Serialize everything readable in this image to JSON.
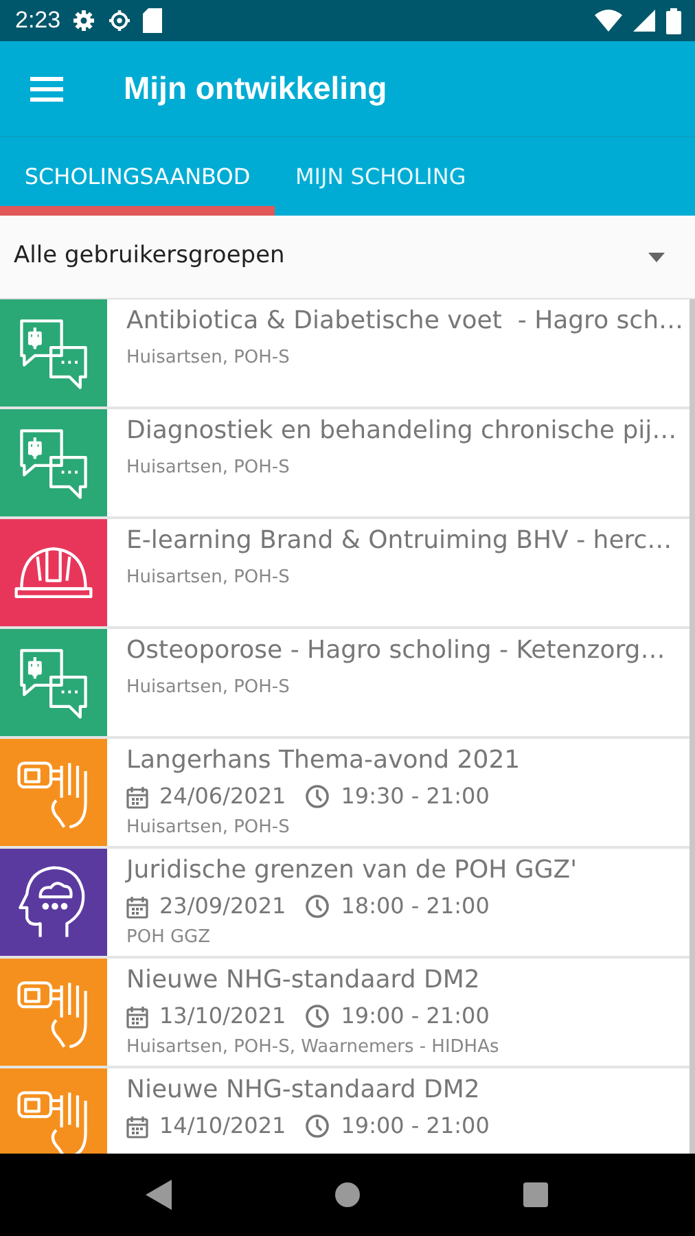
{
  "status_bar": {
    "time": "2:23"
  },
  "app_bar": {
    "title": "Mijn ontwikkeling"
  },
  "tabs": [
    {
      "label": "SCHOLINGSAANBOD",
      "selected": true
    },
    {
      "label": "MIJN SCHOLING",
      "selected": false
    }
  ],
  "filter": {
    "value": "Alle gebruikersgroepen"
  },
  "courses": [
    {
      "kind": "chat",
      "color": "#2aa876",
      "title": "Antibiotica & Diabetische voet  - Hagro sch…",
      "groups": "Huisartsen, POH-S"
    },
    {
      "kind": "chat",
      "color": "#2aa876",
      "title": "Diagnostiek en behandeling chronische pij…",
      "groups": "Huisartsen, POH-S"
    },
    {
      "kind": "helmet",
      "color": "#e8365a",
      "title": "E-learning Brand & Ontruiming BHV - herc…",
      "groups": "Huisartsen, POH-S"
    },
    {
      "kind": "chat",
      "color": "#2aa876",
      "title": "Osteoporose - Hagro scholing - Ketenzorg…",
      "groups": "Huisartsen, POH-S"
    },
    {
      "kind": "hand",
      "color": "#f5901e",
      "title": "Langerhans Thema-avond 2021",
      "date": "24/06/2021",
      "time": "19:30 - 21:00",
      "groups": "Huisartsen, POH-S"
    },
    {
      "kind": "head",
      "color": "#5b3aa0",
      "title": "Juridische grenzen van de POH GGZ'",
      "date": "23/09/2021",
      "time": "18:00 - 21:00",
      "groups": "POH GGZ"
    },
    {
      "kind": "hand",
      "color": "#f5901e",
      "title": "Nieuwe NHG-standaard DM2",
      "date": "13/10/2021",
      "time": "19:00 - 21:00",
      "groups": "Huisartsen, POH-S, Waarnemers - HIDHAs"
    },
    {
      "kind": "hand",
      "color": "#f5901e",
      "title": "Nieuwe NHG-standaard DM2",
      "date": "14/10/2021",
      "time": "19:00 - 21:00"
    }
  ]
}
